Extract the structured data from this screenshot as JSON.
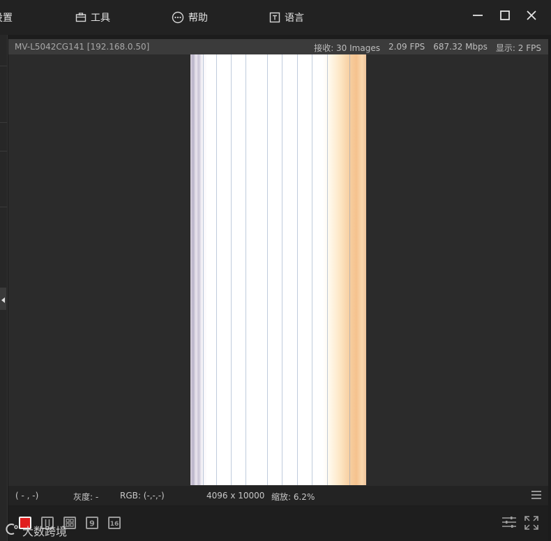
{
  "menubar": {
    "items": [
      {
        "label": "设置",
        "icon": "settings-icon"
      },
      {
        "label": "工具",
        "icon": "toolbox-icon"
      },
      {
        "label": "帮助",
        "icon": "help-icon"
      },
      {
        "label": "语言",
        "icon": "language-icon"
      }
    ],
    "window_controls": [
      "minimize-icon",
      "maximize-icon",
      "close-icon"
    ]
  },
  "infobar": {
    "camera": "MV-L5042CG141 [192.168.0.50]",
    "received": "接收: 30 Images",
    "fps": "2.09 FPS",
    "bandwidth": "687.32 Mbps",
    "display": "显示: 2 FPS"
  },
  "statusbar": {
    "coords": "( - , -)",
    "gray": "灰度: -",
    "rgb": "RGB: (-,-,-)",
    "resolution": "4096 x 10000",
    "zoom": "缩放: 6.2%"
  },
  "bottombar": {
    "layouts": [
      "1",
      "4",
      "9",
      "16"
    ],
    "active_layout": "1",
    "accent_color": "#e01e1e"
  },
  "watermark": {
    "text": "大数跨境"
  }
}
